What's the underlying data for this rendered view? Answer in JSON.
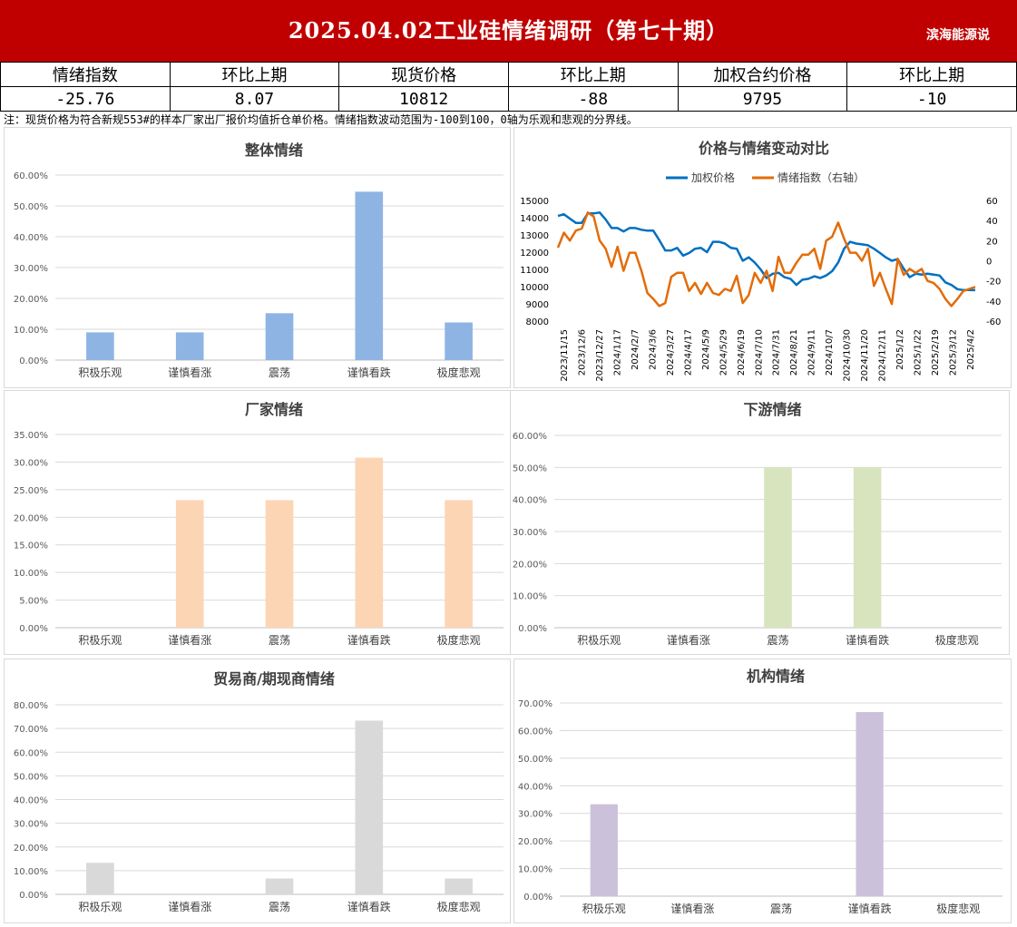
{
  "header": {
    "title": "2025.04.02工业硅情绪调研（第七十期）",
    "brand": "滨海能源说"
  },
  "kpi": {
    "headers": [
      "情绪指数",
      "环比上期",
      "现货价格",
      "环比上期",
      "加权合约价格",
      "环比上期"
    ],
    "values": [
      "-25.76",
      "8.07",
      "10812",
      "-88",
      "9795",
      "-10"
    ]
  },
  "note": "注：现货价格为符合新规553#的样本厂家出厂报价均值折仓单价格。情绪指数波动范围为-100到100，0轴为乐观和悲观的分界线。",
  "colors": {
    "header_bg": "#c00000",
    "overall": "#8eb4e3",
    "factory": "#fcd5b5",
    "downstream": "#d7e4bd",
    "trader": "#d9d9d9",
    "institution": "#ccc1da",
    "price_line": "#0070c0",
    "sentiment_line": "#e36c09"
  },
  "chart_data": [
    {
      "id": "overall",
      "type": "bar",
      "title": "整体情绪",
      "categories": [
        "积极乐观",
        "谨慎看涨",
        "震荡",
        "谨慎看跌",
        "极度悲观"
      ],
      "values": [
        9.0,
        9.0,
        15.2,
        54.6,
        12.2
      ],
      "ylim": [
        0,
        60
      ],
      "yticks": [
        "0.00%",
        "10.00%",
        "20.00%",
        "30.00%",
        "40.00%",
        "50.00%",
        "60.00%"
      ],
      "color": "#8eb4e3"
    },
    {
      "id": "compare",
      "type": "line",
      "title": "价格与情绪变动对比",
      "legend": [
        "加权价格",
        "情绪指数（右轴）"
      ],
      "x_ticks": [
        "2023/11/15",
        "2023/12/6",
        "2023/12/27",
        "2024/1/17",
        "2024/2/7",
        "2024/3/6",
        "2024/3/27",
        "2024/4/17",
        "2024/5/9",
        "2024/5/29",
        "2024/6/19",
        "2024/7/10",
        "2024/7/31",
        "2024/8/21",
        "2024/9/11",
        "2024/10/7",
        "2024/10/30",
        "2024/11/20",
        "2024/12/11",
        "2025/1/2",
        "2025/1/22",
        "2025/2/19",
        "2025/3/12",
        "2025/4/2"
      ],
      "yticks_left": [
        "8000",
        "9000",
        "10000",
        "11000",
        "12000",
        "13000",
        "14000",
        "15000"
      ],
      "yticks_right": [
        "-60",
        "-40",
        "-20",
        "0",
        "20",
        "40",
        "60"
      ],
      "ylim_left": [
        8000,
        15000
      ],
      "ylim_right": [
        -60,
        60
      ],
      "series": [
        {
          "name": "加权价格",
          "axis": "left",
          "values": [
            14100,
            14200,
            13950,
            13700,
            13700,
            14250,
            14250,
            14300,
            13900,
            13400,
            13400,
            13200,
            13400,
            13400,
            13300,
            13250,
            13250,
            12700,
            12100,
            12100,
            12250,
            11800,
            11950,
            12200,
            12250,
            12000,
            12600,
            12600,
            12500,
            12250,
            12200,
            11500,
            11700,
            11400,
            11000,
            10500,
            10750,
            10800,
            10550,
            10450,
            10100,
            10400,
            10450,
            10600,
            10500,
            10650,
            10900,
            11400,
            12200,
            12600,
            12500,
            12450,
            12400,
            12200,
            11950,
            11700,
            11500,
            11600,
            11050,
            10550,
            10750,
            10700,
            10750,
            10700,
            10650,
            10250,
            10100,
            9850,
            9800,
            9800,
            9795
          ]
        },
        {
          "name": "情绪指数（右轴）",
          "axis": "right",
          "values": [
            13,
            28,
            20,
            30,
            32,
            48,
            44,
            20,
            12,
            -6,
            14,
            -10,
            8,
            8,
            -10,
            -32,
            -38,
            -45,
            -42,
            -16,
            -12,
            -12,
            -30,
            -22,
            -33,
            -22,
            -32,
            -34,
            -28,
            -30,
            -15,
            -42,
            -34,
            -12,
            -22,
            -10,
            -30,
            4,
            -12,
            -12,
            -2,
            6,
            6,
            12,
            -8,
            20,
            24,
            38,
            22,
            8,
            8,
            0,
            12,
            -25,
            -12,
            -28,
            -43,
            2,
            -14,
            -8,
            -12,
            -8,
            -20,
            -22,
            -28,
            -38,
            -45,
            -38,
            -30,
            -28,
            -26
          ]
        }
      ]
    },
    {
      "id": "factory",
      "type": "bar",
      "title": "厂家情绪",
      "categories": [
        "积极乐观",
        "谨慎看涨",
        "震荡",
        "谨慎看跌",
        "极度悲观"
      ],
      "values": [
        0,
        23.1,
        23.1,
        30.8,
        23.1
      ],
      "ylim": [
        0,
        35
      ],
      "yticks": [
        "0.00%",
        "5.00%",
        "10.00%",
        "15.00%",
        "20.00%",
        "25.00%",
        "30.00%",
        "35.00%"
      ],
      "color": "#fcd5b5"
    },
    {
      "id": "downstream",
      "type": "bar",
      "title": "下游情绪",
      "categories": [
        "积极乐观",
        "谨慎看涨",
        "震荡",
        "谨慎看跌",
        "极度悲观"
      ],
      "values": [
        0,
        0,
        50,
        50,
        0
      ],
      "ylim": [
        0,
        60
      ],
      "yticks": [
        "0.00%",
        "10.00%",
        "20.00%",
        "30.00%",
        "40.00%",
        "50.00%",
        "60.00%"
      ],
      "color": "#d7e4bd"
    },
    {
      "id": "trader",
      "type": "bar",
      "title": "贸易商/期现商情绪",
      "categories": [
        "积极乐观",
        "谨慎看涨",
        "震荡",
        "谨慎看跌",
        "极度悲观"
      ],
      "values": [
        13.3,
        0,
        6.7,
        73.3,
        6.7
      ],
      "ylim": [
        0,
        80
      ],
      "yticks": [
        "0.00%",
        "10.00%",
        "20.00%",
        "30.00%",
        "40.00%",
        "50.00%",
        "60.00%",
        "70.00%",
        "80.00%"
      ],
      "color": "#d9d9d9"
    },
    {
      "id": "institution",
      "type": "bar",
      "title": "机构情绪",
      "categories": [
        "积极乐观",
        "谨慎看涨",
        "震荡",
        "谨慎看跌",
        "极度悲观"
      ],
      "values": [
        33.3,
        0,
        0,
        66.7,
        0
      ],
      "ylim": [
        0,
        70
      ],
      "yticks": [
        "0.00%",
        "10.00%",
        "20.00%",
        "30.00%",
        "40.00%",
        "50.00%",
        "60.00%",
        "70.00%"
      ],
      "color": "#ccc1da"
    }
  ]
}
